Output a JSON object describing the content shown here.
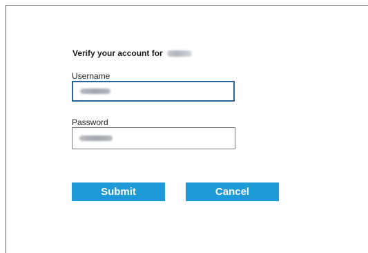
{
  "dialog": {
    "heading": "Verify your account for",
    "account_name": "",
    "username": {
      "label": "Username",
      "value": ""
    },
    "password": {
      "label": "Password",
      "value": ""
    },
    "buttons": {
      "submit": "Submit",
      "cancel": "Cancel"
    }
  },
  "colors": {
    "button_bg": "#1e9ad6",
    "button_text": "#ffffff",
    "focused_border": "#2a6496",
    "border": "#7a7a7a"
  }
}
